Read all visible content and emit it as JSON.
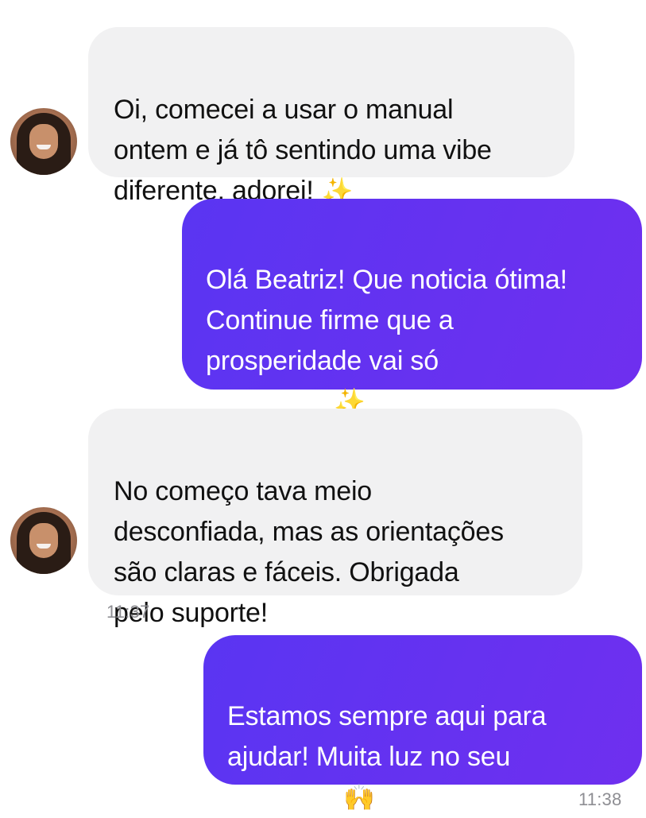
{
  "colors": {
    "incoming_bubble": "#f1f1f2",
    "outgoing_bubble_start": "#5a35f2",
    "outgoing_bubble_end": "#6f2fef",
    "timestamp_text": "#8e8e93"
  },
  "messages": [
    {
      "direction": "incoming",
      "sender": "Beatriz",
      "text": "Oi, comecei a usar o manual\nontem e já tô sentindo uma vibe\ndiferente, adorei!",
      "emoji": "✨",
      "emoji_name": "sparkles-emoji",
      "time": ""
    },
    {
      "direction": "outgoing",
      "text": "Olá Beatriz! Que noticia ótima!\nContinue firme que a\nprosperidade vai só\naumentar!",
      "emoji": "✨",
      "emoji_name": "sparkles-emoji",
      "time": ""
    },
    {
      "direction": "incoming",
      "sender": "Beatriz",
      "text": "No começo tava meio\ndesconfiada, mas as orientações\nsão claras e fáceis. Obrigada\npelo suporte!",
      "time": "11:37"
    },
    {
      "direction": "outgoing",
      "text": "Estamos sempre aqui para\najudar! Muita luz no seu\ncaminho!",
      "emoji": "🙌",
      "emoji_name": "raised-hands-emoji",
      "time": "11:38"
    }
  ]
}
